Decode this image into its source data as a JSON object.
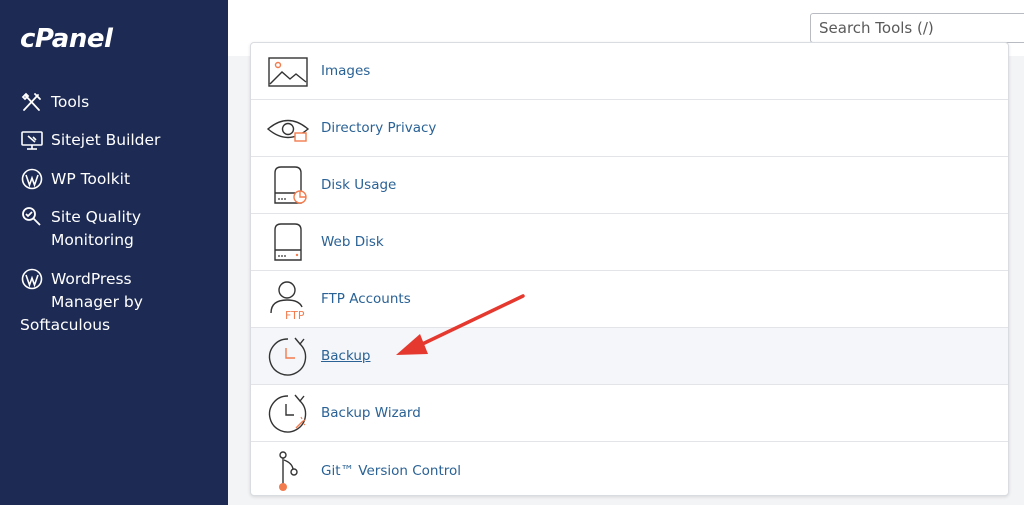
{
  "brand": {
    "logo_text": "cPanel"
  },
  "sidebar": {
    "items": [
      {
        "label": "Tools",
        "icon": "tools-icon"
      },
      {
        "label": "Sitejet Builder",
        "icon": "sitejet-builder-icon"
      },
      {
        "label": "WP Toolkit",
        "icon": "wordpress-icon"
      },
      {
        "label": "Site Quality",
        "label2": "Monitoring",
        "icon": "magnifier-icon"
      },
      {
        "label": "WordPress",
        "label2": "Manager by",
        "label3": "Softaculous",
        "icon": "wordpress-icon"
      }
    ]
  },
  "search": {
    "placeholder": "Search Tools (/)"
  },
  "tools": [
    {
      "label": "Images",
      "icon": "images-icon"
    },
    {
      "label": "Directory Privacy",
      "icon": "directory-privacy-icon"
    },
    {
      "label": "Disk Usage",
      "icon": "disk-usage-icon"
    },
    {
      "label": "Web Disk",
      "icon": "web-disk-icon"
    },
    {
      "label": "FTP Accounts",
      "icon": "ftp-accounts-icon",
      "icon_text": "FTP"
    },
    {
      "label": "Backup",
      "icon": "backup-icon",
      "highlighted": true
    },
    {
      "label": "Backup Wizard",
      "icon": "backup-wizard-icon"
    },
    {
      "label": "Git™ Version Control",
      "icon": "git-icon"
    }
  ],
  "colors": {
    "sidebar_bg": "#1c2a54",
    "link": "#2a6295",
    "accent": "#f37c4f",
    "annotation_arrow": "#e5392f"
  }
}
